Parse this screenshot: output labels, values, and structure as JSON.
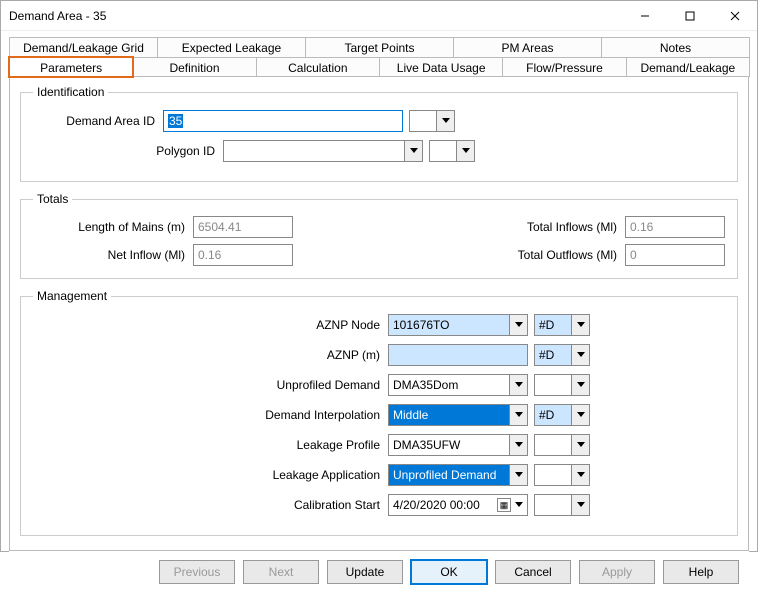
{
  "window": {
    "title": "Demand Area - 35"
  },
  "tabs_row1": [
    {
      "label": "Demand/Leakage Grid"
    },
    {
      "label": "Expected Leakage"
    },
    {
      "label": "Target Points"
    },
    {
      "label": "PM Areas"
    },
    {
      "label": "Notes"
    }
  ],
  "tabs_row2": [
    {
      "label": "Parameters"
    },
    {
      "label": "Definition"
    },
    {
      "label": "Calculation"
    },
    {
      "label": "Live Data Usage"
    },
    {
      "label": "Flow/Pressure"
    },
    {
      "label": "Demand/Leakage"
    }
  ],
  "identification": {
    "legend": "Identification",
    "demand_area_id_label": "Demand Area ID",
    "demand_area_id_value": "35",
    "polygon_id_label": "Polygon ID",
    "polygon_id_value": ""
  },
  "totals": {
    "legend": "Totals",
    "length_mains_label": "Length of Mains (m)",
    "length_mains_value": "6504.41",
    "total_inflows_label": "Total Inflows (Ml)",
    "total_inflows_value": "0.16",
    "net_inflow_label": "Net Inflow (Ml)",
    "net_inflow_value": "0.16",
    "total_outflows_label": "Total Outflows (Ml)",
    "total_outflows_value": "0"
  },
  "management": {
    "legend": "Management",
    "aznp_node_label": "AZNP Node",
    "aznp_node_value": "101676TO",
    "aznp_node_flag": "#D",
    "aznp_m_label": "AZNP (m)",
    "aznp_m_value": "",
    "aznp_m_flag": "#D",
    "unprofiled_demand_label": "Unprofiled Demand",
    "unprofiled_demand_value": "DMA35Dom",
    "unprofiled_demand_flag": "",
    "demand_interp_label": "Demand Interpolation",
    "demand_interp_value": "Middle",
    "demand_interp_flag": "#D",
    "leakage_profile_label": "Leakage Profile",
    "leakage_profile_value": "DMA35UFW",
    "leakage_profile_flag": "",
    "leakage_app_label": "Leakage Application",
    "leakage_app_value": "Unprofiled Demand",
    "leakage_app_flag": "",
    "calib_start_label": "Calibration Start",
    "calib_start_value": "4/20/2020 00:00",
    "calib_start_flag": ""
  },
  "footer": {
    "previous": "Previous",
    "next": "Next",
    "update": "Update",
    "ok": "OK",
    "cancel": "Cancel",
    "apply": "Apply",
    "help": "Help"
  }
}
